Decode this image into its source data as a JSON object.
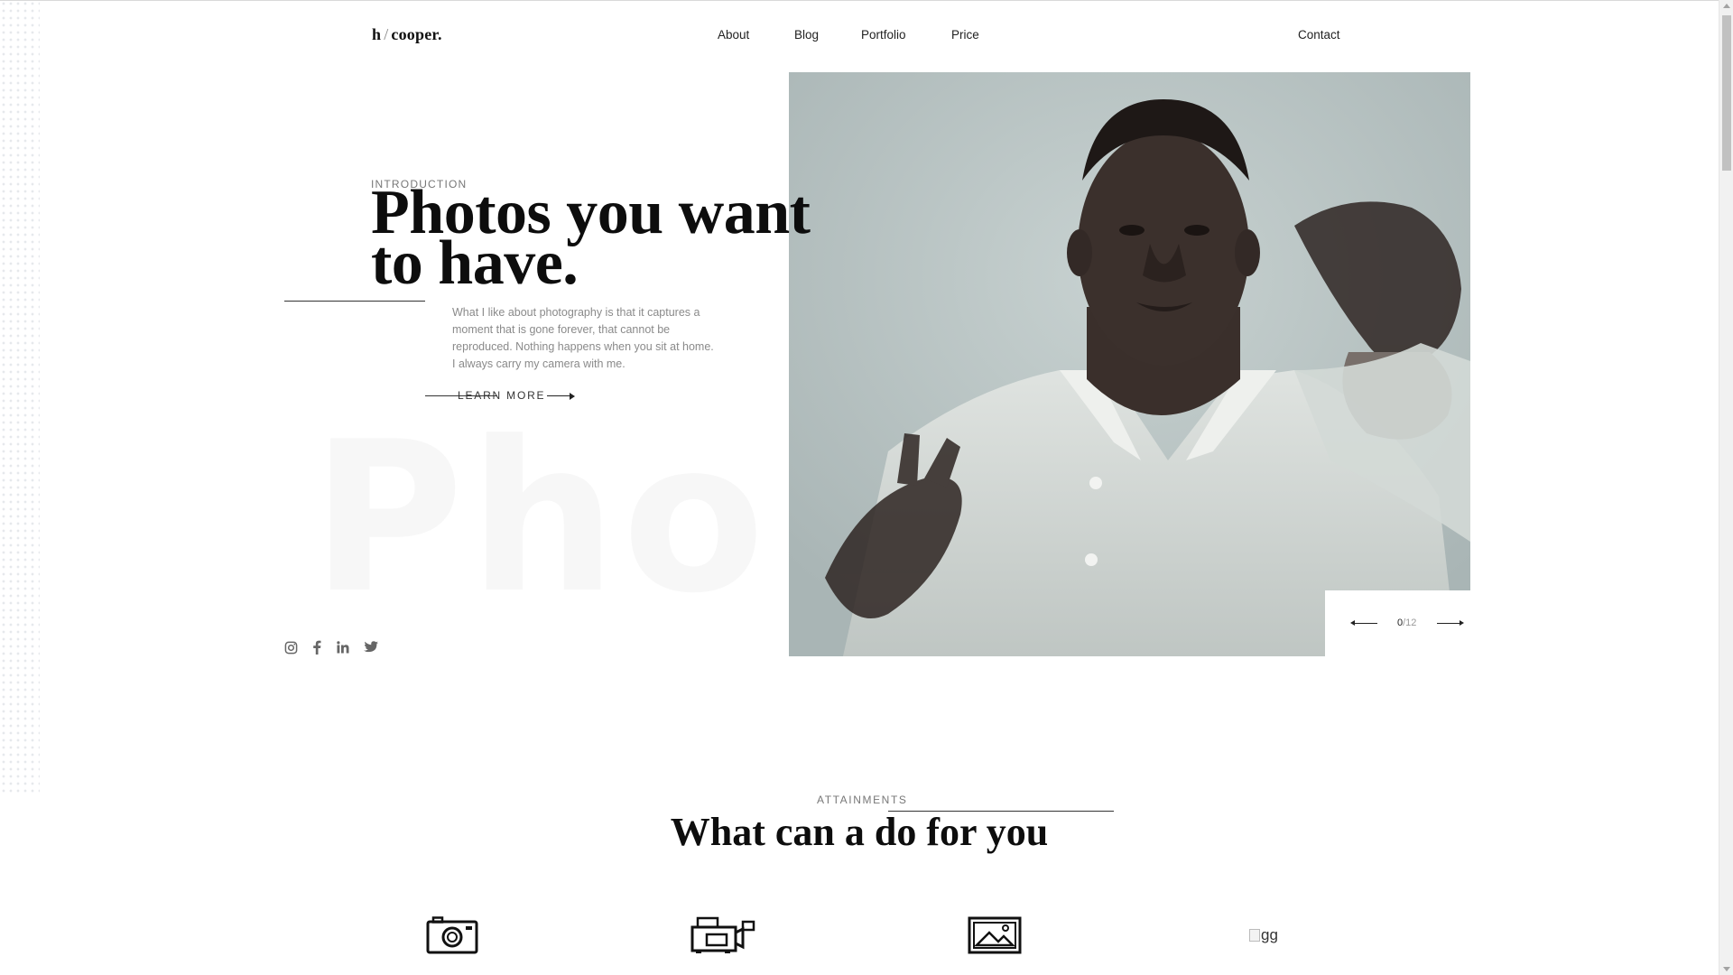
{
  "header": {
    "logo": {
      "initial": "h",
      "slash": "/",
      "name": "cooper."
    },
    "nav": [
      {
        "label": "About"
      },
      {
        "label": "Blog"
      },
      {
        "label": "Portfolio"
      },
      {
        "label": "Price"
      }
    ],
    "contact_label": "Contact"
  },
  "hero": {
    "label": "INTRODUCTION",
    "title_line1": "Photos you want",
    "title_line2": "to have.",
    "description": "What I like about photography is that it captures a moment that is gone forever, that cannot be reproduced. Nothing happens when you sit at home. I always carry my camera with me.",
    "cta_label": "LEARN MORE",
    "background_word": "Photo",
    "social_icons": [
      "instagram-icon",
      "facebook-icon",
      "linkedin-icon",
      "twitter-icon"
    ]
  },
  "slider": {
    "current": "0",
    "total": "/12"
  },
  "attainments": {
    "label": "ATTAINMENTS",
    "title": "What can a do for you",
    "services": [
      {
        "icon": "camera-icon"
      },
      {
        "icon": "video-camera-icon"
      },
      {
        "icon": "picture-icon"
      },
      {
        "icon": "broken-image",
        "alt": "gg"
      }
    ]
  }
}
